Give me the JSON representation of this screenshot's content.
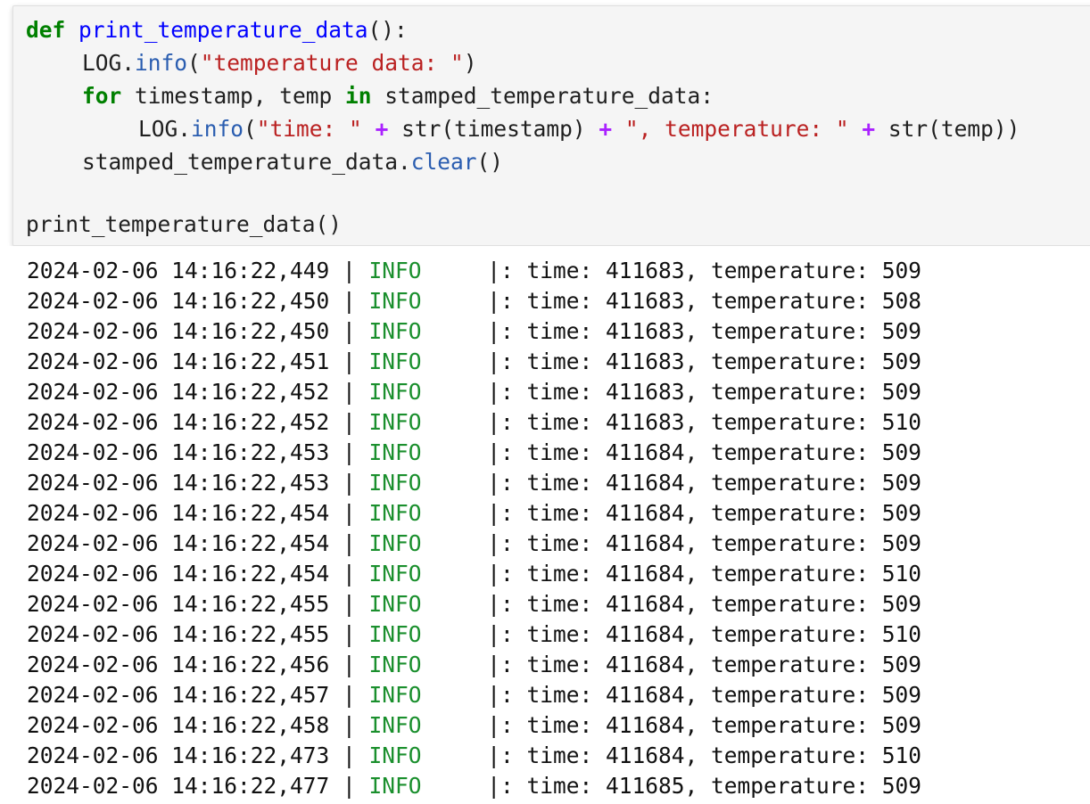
{
  "code_cell": {
    "lines": [
      {
        "kw": "def",
        "fn": "print_temperature_data",
        "rest": "():"
      },
      {
        "obj": "LOG.",
        "method": "info",
        "open": "(",
        "str": "\"temperature data: \"",
        "close": ")"
      },
      {
        "kw1": "for",
        "mid": " timestamp, temp ",
        "kw2": "in",
        "tail": " stamped_temperature_data:"
      },
      {
        "obj": "LOG.",
        "method": "info",
        "open": "(",
        "s1": "\"time: \"",
        "op1": " + ",
        "fn1": "str(timestamp)",
        "op2": " + ",
        "s2": "\", temperature: \"",
        "op3": " + ",
        "fn2": "str(temp))"
      },
      {
        "obj": "stamped_temperature_data.",
        "method": "clear",
        "close": "()"
      },
      {
        "call": "print_temperature_data()"
      }
    ]
  },
  "output": {
    "level_color": "#1a8f2d",
    "rows": [
      {
        "ts": "2024-02-06 14:16:22,449",
        "level": "INFO",
        "time": "411683",
        "temp": "509"
      },
      {
        "ts": "2024-02-06 14:16:22,450",
        "level": "INFO",
        "time": "411683",
        "temp": "508"
      },
      {
        "ts": "2024-02-06 14:16:22,450",
        "level": "INFO",
        "time": "411683",
        "temp": "509"
      },
      {
        "ts": "2024-02-06 14:16:22,451",
        "level": "INFO",
        "time": "411683",
        "temp": "509"
      },
      {
        "ts": "2024-02-06 14:16:22,452",
        "level": "INFO",
        "time": "411683",
        "temp": "509"
      },
      {
        "ts": "2024-02-06 14:16:22,452",
        "level": "INFO",
        "time": "411683",
        "temp": "510"
      },
      {
        "ts": "2024-02-06 14:16:22,453",
        "level": "INFO",
        "time": "411684",
        "temp": "509"
      },
      {
        "ts": "2024-02-06 14:16:22,453",
        "level": "INFO",
        "time": "411684",
        "temp": "509"
      },
      {
        "ts": "2024-02-06 14:16:22,454",
        "level": "INFO",
        "time": "411684",
        "temp": "509"
      },
      {
        "ts": "2024-02-06 14:16:22,454",
        "level": "INFO",
        "time": "411684",
        "temp": "509"
      },
      {
        "ts": "2024-02-06 14:16:22,454",
        "level": "INFO",
        "time": "411684",
        "temp": "510"
      },
      {
        "ts": "2024-02-06 14:16:22,455",
        "level": "INFO",
        "time": "411684",
        "temp": "509"
      },
      {
        "ts": "2024-02-06 14:16:22,455",
        "level": "INFO",
        "time": "411684",
        "temp": "510"
      },
      {
        "ts": "2024-02-06 14:16:22,456",
        "level": "INFO",
        "time": "411684",
        "temp": "509"
      },
      {
        "ts": "2024-02-06 14:16:22,457",
        "level": "INFO",
        "time": "411684",
        "temp": "509"
      },
      {
        "ts": "2024-02-06 14:16:22,458",
        "level": "INFO",
        "time": "411684",
        "temp": "509"
      },
      {
        "ts": "2024-02-06 14:16:22,473",
        "level": "INFO",
        "time": "411684",
        "temp": "510"
      },
      {
        "ts": "2024-02-06 14:16:22,477",
        "level": "INFO",
        "time": "411685",
        "temp": "509"
      }
    ]
  }
}
